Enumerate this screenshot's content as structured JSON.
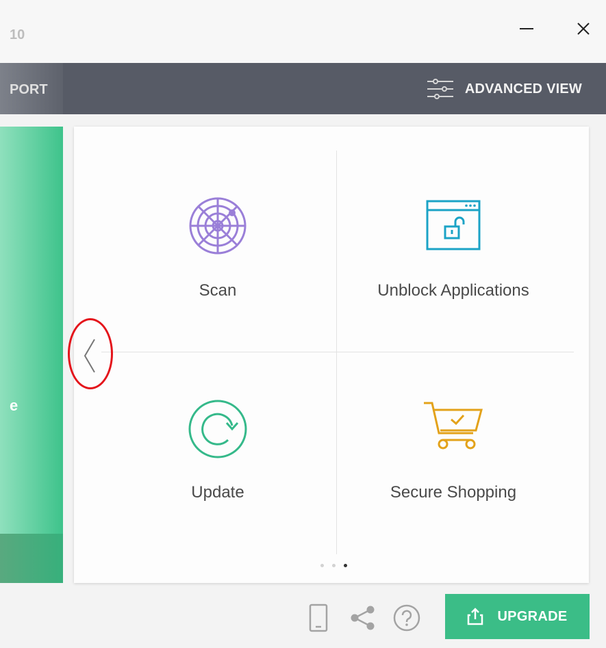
{
  "window": {
    "title_fragment": "10",
    "minimize_icon": "minimize-icon",
    "close_icon": "close-icon"
  },
  "nav": {
    "left_fragment": "PORT",
    "advanced_view_label": "ADVANCED VIEW",
    "advanced_view_icon": "sliders-icon"
  },
  "left_panel": {
    "fragment": "e"
  },
  "tiles": [
    {
      "label": "Scan",
      "icon": "radar-scan-icon",
      "color": "#9a7fd8"
    },
    {
      "label": "Unblock Applications",
      "icon": "unlock-window-icon",
      "color": "#1ba3c6"
    },
    {
      "label": "Update",
      "icon": "refresh-circle-icon",
      "color": "#35b98a"
    },
    {
      "label": "Secure Shopping",
      "icon": "shopping-cart-check-icon",
      "color": "#e3a21a"
    }
  ],
  "pagination": {
    "total": 3,
    "active_page": 3
  },
  "footer": {
    "upgrade_label": "UPGRADE",
    "upgrade_color": "#3bbd87",
    "icons": [
      "mobile-icon",
      "share-icon",
      "help-icon"
    ]
  },
  "colors": {
    "navbar": "#575b66",
    "green_panel": "#3ec38b",
    "highlight_circle": "#e4141b"
  }
}
